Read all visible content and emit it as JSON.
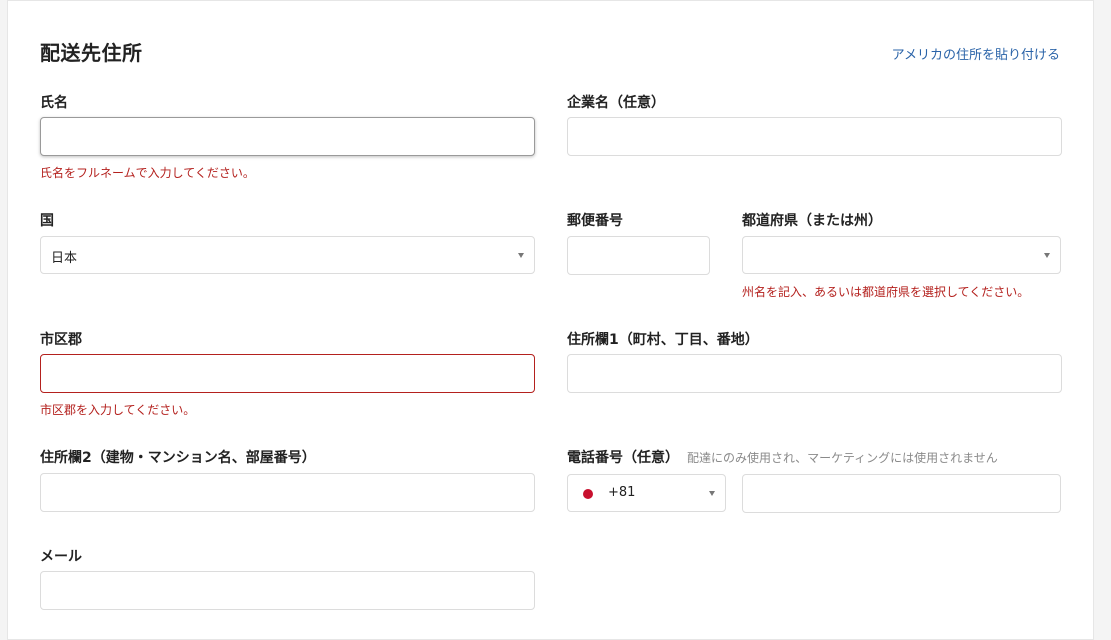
{
  "section_title": "配送先住所",
  "paste_link": "アメリカの住所を貼り付ける",
  "full_name": {
    "label": "氏名",
    "value": "",
    "error": "氏名をフルネームで入力してください。"
  },
  "company": {
    "label": "企業名（任意）",
    "value": ""
  },
  "country": {
    "label": "国",
    "selected": "日本"
  },
  "postal_code": {
    "label": "郵便番号",
    "value": ""
  },
  "prefecture": {
    "label": "都道府県（または州）",
    "selected": "",
    "error": "州名を記入、あるいは都道府県を選択してください。"
  },
  "city": {
    "label": "市区郡",
    "value": "",
    "error": "市区郡を入力してください。"
  },
  "address1": {
    "label": "住所欄1（町村、丁目、番地）",
    "value": ""
  },
  "address2": {
    "label": "住所欄2（建物・マンション名、部屋番号）",
    "value": ""
  },
  "phone": {
    "label": "電話番号（任意）",
    "hint": "配達にのみ使用され、マーケティングには使用されません",
    "dial_code": "+81",
    "value": ""
  },
  "email": {
    "label": "メール",
    "value": ""
  },
  "colors": {
    "error": "#b4211e",
    "link": "#2a63a8",
    "flag": "#c8102e"
  }
}
